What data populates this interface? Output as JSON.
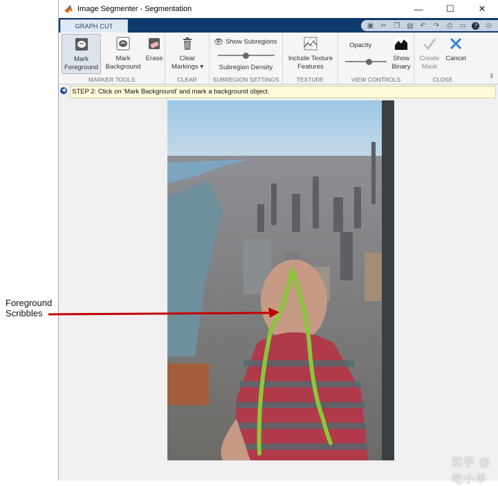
{
  "window": {
    "title": "Image Segmenter - Segmentation",
    "controls": {
      "minimize": "—",
      "maximize": "☐",
      "close": "✕"
    }
  },
  "tabs": [
    {
      "label": "GRAPH CUT"
    }
  ],
  "quick_access_icons": [
    "save-icon",
    "cut-icon",
    "copy-icon",
    "paste-icon",
    "undo-icon",
    "redo-icon",
    "print-icon",
    "layout-icon",
    "help-icon",
    "expand-icon"
  ],
  "toolstrip": {
    "marker_tools": {
      "label": "MARKER TOOLS",
      "mark_foreground_line1": "Mark",
      "mark_foreground_line2": "Foreground",
      "mark_background_line1": "Mark",
      "mark_background_line2": "Background",
      "erase": "Erase"
    },
    "clear": {
      "label": "CLEAR",
      "clear_markings_line1": "Clear",
      "clear_markings_line2": "Markings ▾"
    },
    "subregion_settings": {
      "label": "SUBREGION SETTINGS",
      "show_subregions": "Show Subregions",
      "density": "Subregion Density"
    },
    "texture": {
      "label": "TEXTURE",
      "include_texture_line1": "Include Texture",
      "include_texture_line2": "Features"
    },
    "view_controls": {
      "label": "VIEW CONTROLS",
      "opacity": "Opacity",
      "show_binary_line1": "Show",
      "show_binary_line2": "Binary"
    },
    "close": {
      "label": "CLOSE",
      "create_mask_line1": "Create",
      "create_mask_line2": "Mask",
      "cancel": "Cancel"
    }
  },
  "step": {
    "message": "STEP 2: Click on 'Mark Background' and mark a background object."
  },
  "annotation": {
    "line1": "Foreground",
    "line2": "Scribbles",
    "color": "#c00000"
  },
  "scribble_color": "#8ac83a",
  "watermark": "知乎 @吃小羊"
}
